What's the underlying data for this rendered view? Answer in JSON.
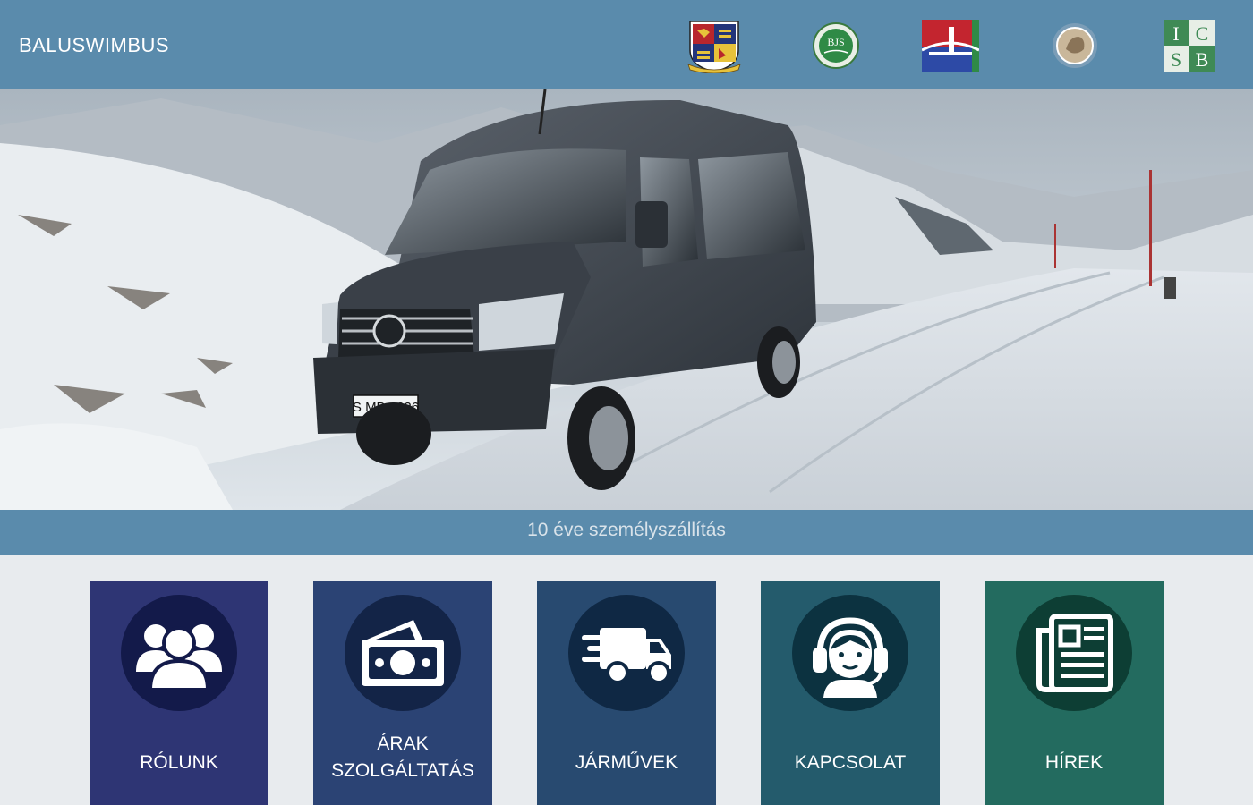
{
  "header": {
    "brand": "BALUSWIMBUS",
    "logos": [
      {
        "name": "crest-logo"
      },
      {
        "name": "bjs-logo",
        "text": "BJS"
      },
      {
        "name": "bridge-logo"
      },
      {
        "name": "seal-logo"
      },
      {
        "name": "icsb-logo",
        "text": "ICSB"
      }
    ]
  },
  "hero": {
    "plate": "S MB 6226"
  },
  "caption": "10 éve személyszállítás",
  "tiles": [
    {
      "label": "RÓLUNK",
      "icon": "group-icon"
    },
    {
      "label_line1": "ÁRAK",
      "label_line2": "SZOLGÁLTATÁS",
      "icon": "money-icon"
    },
    {
      "label": "JÁRMŰVEK",
      "icon": "delivery-truck-icon"
    },
    {
      "label": "KAPCSOLAT",
      "icon": "headset-support-icon"
    },
    {
      "label": "HÍREK",
      "icon": "newspaper-icon"
    }
  ],
  "colors": {
    "header_bg": "#5a8bac",
    "page_bg": "#e8ebee",
    "tile_1": "#2e3574",
    "tile_2": "#2b4374",
    "tile_3": "#284a70",
    "tile_4": "#245b6c",
    "tile_5": "#236b5f"
  }
}
